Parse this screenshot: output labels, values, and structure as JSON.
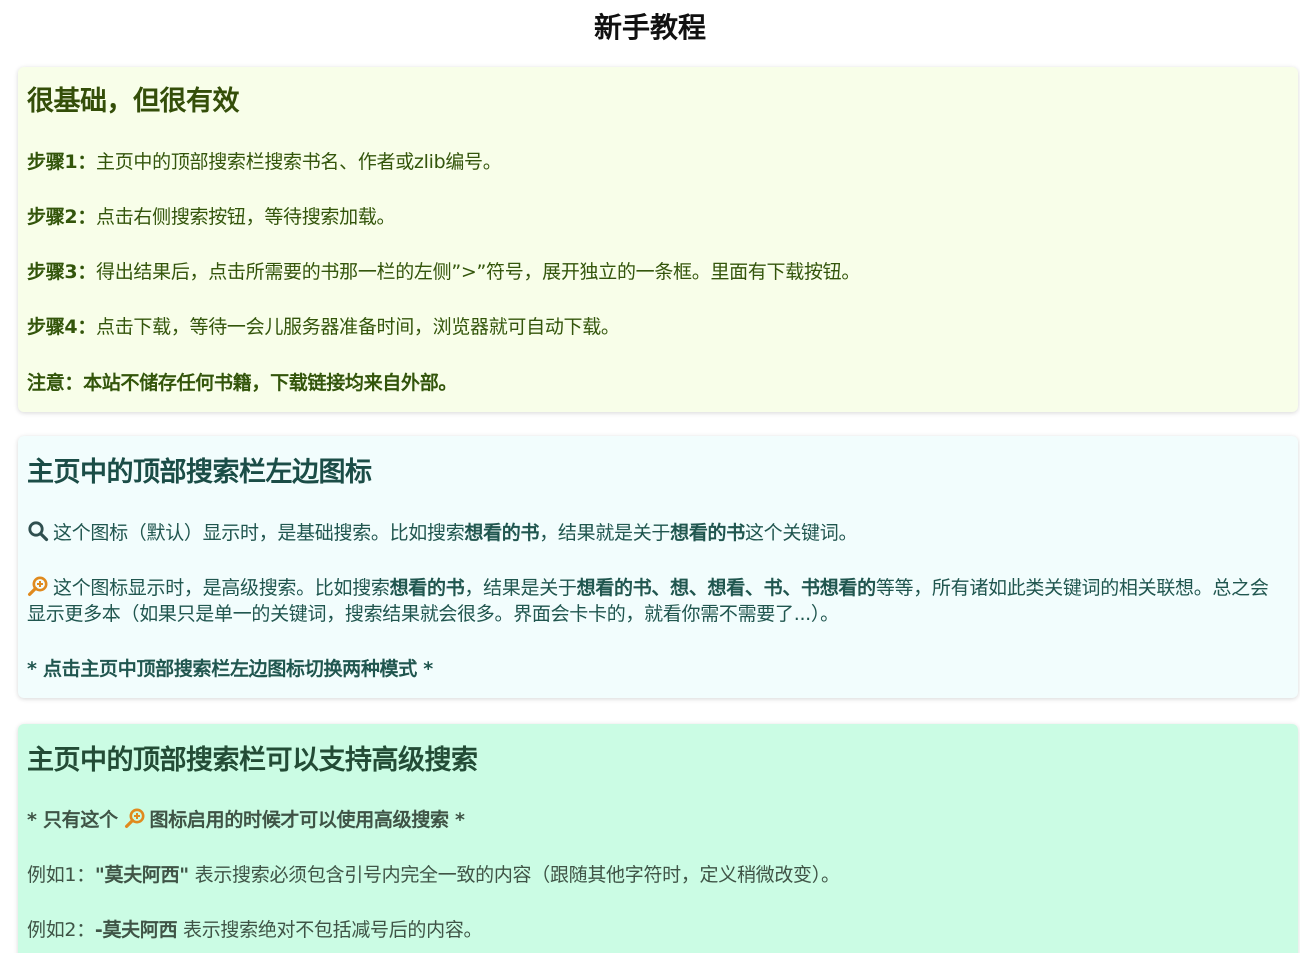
{
  "page": {
    "title": "新手教程"
  },
  "basic": {
    "heading": "很基础，但很有效",
    "steps": [
      {
        "label": "步骤1：",
        "text": "主页中的顶部搜索栏搜索书名、作者或zlib编号。"
      },
      {
        "label": "步骤2：",
        "text": "点击右侧搜索按钮，等待搜索加载。"
      },
      {
        "label": "步骤3：",
        "text": "得出结果后，点击所需要的书那一栏的左侧”>”符号，展开独立的一条框。里面有下载按钮。"
      },
      {
        "label": "步骤4：",
        "text": "点击下载，等待一会儿服务器准备时间，浏览器就可自动下载。"
      }
    ],
    "note_label": "注意：",
    "note_text": "本站不储存任何书籍，下载链接均来自外部。"
  },
  "icon_section": {
    "heading": "主页中的顶部搜索栏左边图标",
    "default_line": {
      "icon": "search-icon",
      "t1": "这个图标（默认）显示时，是基础搜索。比如搜索",
      "b1": "想看的书",
      "t2": "，结果就是关于",
      "b2": "想看的书",
      "t3": "这个关键词。"
    },
    "advanced_line": {
      "icon": "advanced-search-icon",
      "t1": "这个图标显示时，是高级搜索。比如搜索",
      "b1": "想看的书",
      "t2": "，结果是关于",
      "b2": "想看的书、想、想看、书、书想看的",
      "t3": "等等，所有诸如此类关键词的相关联想。总之会显示更多本（如果只是单一的关键词，搜索结果就会很多。界面会卡卡的，就看你需不需要了...）。"
    },
    "toggle_note": "* 点击主页中顶部搜索栏左边图标切换两种模式 *"
  },
  "advanced_section": {
    "heading": "主页中的顶部搜索栏可以支持高级搜索",
    "only_note_pre": "* 只有这个",
    "only_note_post": "图标启用的时候才可以使用高级搜索 *",
    "example1_label": "例如1：",
    "example1_term": "\"莫夫阿西\"",
    "example1_text": "表示搜索必须包含引号内完全一致的内容（跟随其他字符时，定义稍微改变）。",
    "example2_label": "例如2：",
    "example2_term": "-莫夫阿西",
    "example2_text": "表示搜索绝对不包括减号后的内容。"
  },
  "colors": {
    "card1_bg": "#f8fee9",
    "card2_bg": "#f2fdfd",
    "card3_bg": "#cbfce4",
    "search_icon": "#2f4f4f",
    "advanced_icon": "#e08a1e"
  }
}
